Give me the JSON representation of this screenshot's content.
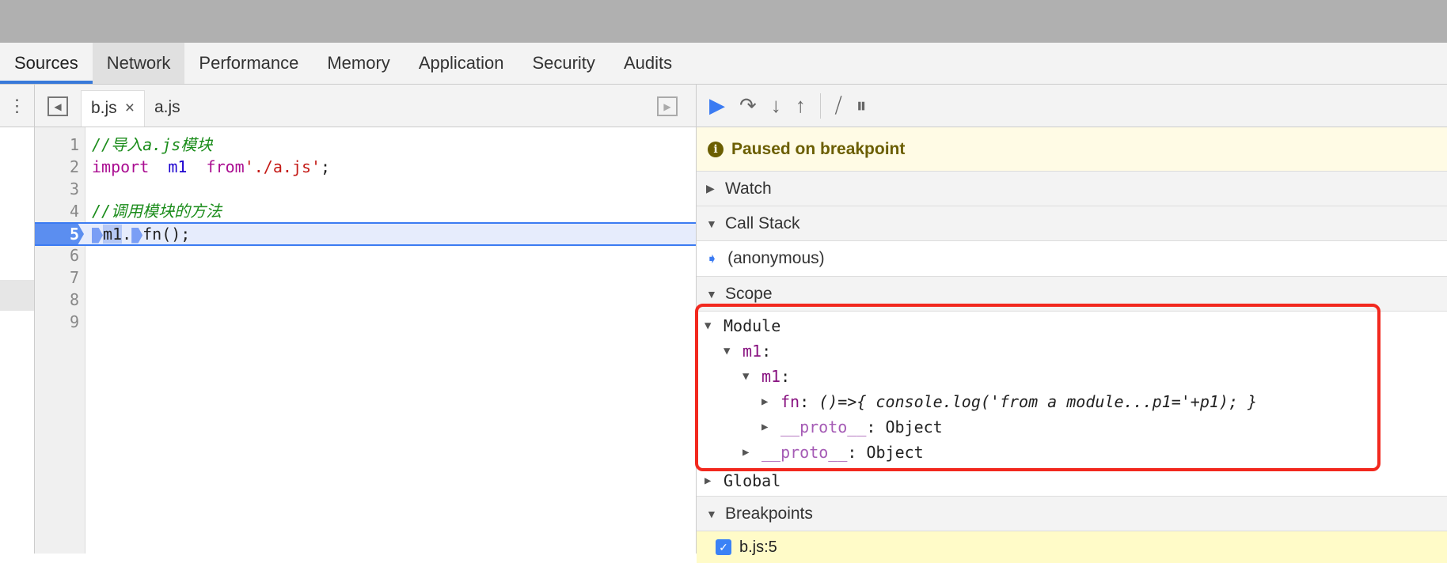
{
  "panel_tabs": [
    "Sources",
    "Network",
    "Performance",
    "Memory",
    "Application",
    "Security",
    "Audits"
  ],
  "editor": {
    "files": [
      {
        "name": "b.js",
        "close": "×"
      },
      {
        "name": "a.js"
      }
    ],
    "lines": [
      {
        "n": "1",
        "parts": [
          {
            "c": "cm",
            "t": "//导入a.js模块"
          }
        ]
      },
      {
        "n": "2",
        "parts": [
          {
            "c": "kw",
            "t": "import"
          },
          {
            "c": "",
            "t": "  "
          },
          {
            "c": "var",
            "t": "m1"
          },
          {
            "c": "",
            "t": "  "
          },
          {
            "c": "kw",
            "t": "from"
          },
          {
            "c": "str",
            "t": "'./a.js'"
          },
          {
            "c": "",
            "t": ";"
          }
        ]
      },
      {
        "n": "3",
        "parts": []
      },
      {
        "n": "4",
        "parts": [
          {
            "c": "cm",
            "t": "//调用模块的方法"
          }
        ]
      },
      {
        "n": "5",
        "current": true,
        "parts": [
          {
            "c": "bp",
            "t": ""
          },
          {
            "c": "hl",
            "t": "m1"
          },
          {
            "c": "",
            "t": "."
          },
          {
            "c": "bp",
            "t": ""
          },
          {
            "c": "",
            "t": "fn();"
          }
        ]
      },
      {
        "n": "6",
        "parts": []
      },
      {
        "n": "7",
        "parts": []
      },
      {
        "n": "8",
        "parts": []
      },
      {
        "n": "9",
        "parts": []
      }
    ]
  },
  "debugger": {
    "paused": "Paused on breakpoint",
    "watch": "Watch",
    "call_stack": "Call Stack",
    "frame": "(anonymous)",
    "scope": "Scope",
    "module": "Module",
    "m1_outer": "m1",
    "m1_inner": "m1",
    "fn_key": "fn",
    "fn_value": "()=>{ console.log('from a module...p1='+p1); }",
    "proto_key": "__proto__",
    "proto_value": "Object",
    "global": "Global",
    "breakpoints": "Breakpoints",
    "bp_item": "b.js:5"
  }
}
